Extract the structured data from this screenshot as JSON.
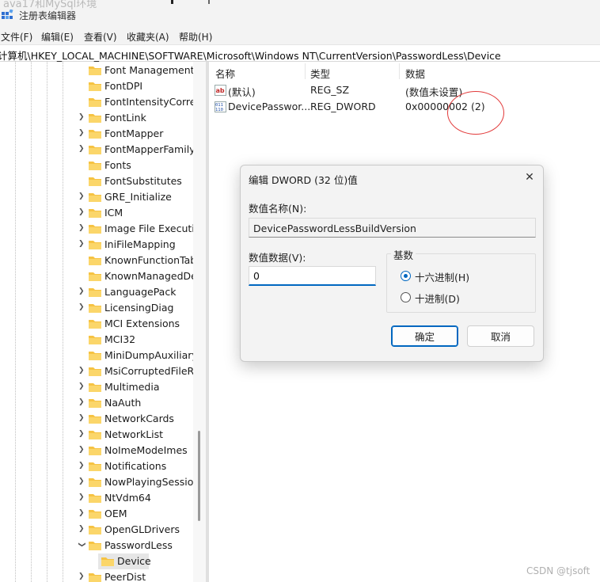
{
  "window": {
    "ghost_text": "ava17和MySql环境",
    "title": "注册表编辑器"
  },
  "menu": [
    "文件(F)",
    "编辑(E)",
    "查看(V)",
    "收藏夹(A)",
    "帮助(H)"
  ],
  "address": "计算机\\HKEY_LOCAL_MACHINE\\SOFTWARE\\Microsoft\\Windows NT\\CurrentVersion\\PasswordLess\\Device",
  "tree": {
    "items": [
      {
        "label": "Font Management",
        "chevron": false
      },
      {
        "label": "FontDPI",
        "chevron": false
      },
      {
        "label": "FontIntensityCorrection",
        "chevron": false
      },
      {
        "label": "FontLink",
        "chevron": true
      },
      {
        "label": "FontMapper",
        "chevron": true
      },
      {
        "label": "FontMapperFamilyFallback",
        "chevron": true
      },
      {
        "label": "Fonts",
        "chevron": false
      },
      {
        "label": "FontSubstitutes",
        "chevron": false
      },
      {
        "label": "GRE_Initialize",
        "chevron": true
      },
      {
        "label": "ICM",
        "chevron": true
      },
      {
        "label": "Image File Execution Options",
        "chevron": true
      },
      {
        "label": "IniFileMapping",
        "chevron": true
      },
      {
        "label": "KnownFunctionTableDlls",
        "chevron": false
      },
      {
        "label": "KnownManagedDebuggingDlls",
        "chevron": false
      },
      {
        "label": "LanguagePack",
        "chevron": true
      },
      {
        "label": "LicensingDiag",
        "chevron": true
      },
      {
        "label": "MCI Extensions",
        "chevron": false
      },
      {
        "label": "MCI32",
        "chevron": false
      },
      {
        "label": "MiniDumpAuxiliaryDlls",
        "chevron": false
      },
      {
        "label": "MsiCorruptedFileRecovery",
        "chevron": true
      },
      {
        "label": "Multimedia",
        "chevron": true
      },
      {
        "label": "NaAuth",
        "chevron": true
      },
      {
        "label": "NetworkCards",
        "chevron": true
      },
      {
        "label": "NetworkList",
        "chevron": true
      },
      {
        "label": "NoImeModeImes",
        "chevron": true
      },
      {
        "label": "Notifications",
        "chevron": true
      },
      {
        "label": "NowPlayingSessionManager",
        "chevron": true
      },
      {
        "label": "NtVdm64",
        "chevron": true
      },
      {
        "label": "OEM",
        "chevron": true
      },
      {
        "label": "OpenGLDrivers",
        "chevron": true
      },
      {
        "label": "PasswordLess",
        "chevron": "open"
      },
      {
        "label": "Device",
        "chevron": false,
        "child": true,
        "selected": true
      },
      {
        "label": "PeerDist",
        "chevron": true
      }
    ]
  },
  "list": {
    "headers": [
      "名称",
      "类型",
      "数据"
    ],
    "rows": [
      {
        "icon": "string-value-icon",
        "name": "(默认)",
        "type": "REG_SZ",
        "data": "(数值未设置)"
      },
      {
        "icon": "dword-value-icon",
        "name": "DevicePasswor...",
        "type": "REG_DWORD",
        "data": "0x00000002 (2)"
      }
    ]
  },
  "dialog": {
    "title": "编辑 DWORD (32 位)值",
    "name_label": "数值名称(N):",
    "name_value": "DevicePasswordLessBuildVersion",
    "data_label": "数值数据(V):",
    "data_value": "0",
    "base_label": "基数",
    "hex_label": "十六进制(H)",
    "dec_label": "十进制(D)",
    "selected_base": "hex",
    "ok_label": "确定",
    "cancel_label": "取消"
  },
  "watermark": "CSDN @tjsoft",
  "colors": {
    "accent": "#0067c0",
    "annotation": "#e23b3b",
    "folder": "#f6c343"
  }
}
